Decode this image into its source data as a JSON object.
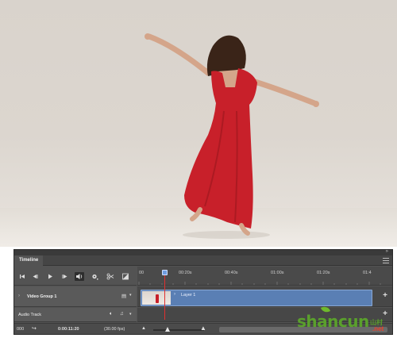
{
  "panel": {
    "title": "Timeline"
  },
  "controls": {
    "go_first": "⏮",
    "prev_frame": "◀",
    "play": "▶",
    "next_frame": "▶",
    "audio": "🔊",
    "settings": "✱",
    "split": "✂",
    "transition": "◪"
  },
  "ruler": {
    "ticks": [
      "00",
      "00:20s",
      "00:40s",
      "01:00s",
      "01:20s",
      "01:4"
    ]
  },
  "tracks": {
    "video_group": {
      "name": "Video Group 1",
      "clip_label": "Layer 1"
    },
    "audio": {
      "name": "Audio Track"
    }
  },
  "bottom": {
    "frame": "000",
    "timecode": "0:00:11:20",
    "fps": "(30.00 fps)"
  },
  "watermark": {
    "main": "shancun",
    "small": "山村",
    "net": ".net"
  },
  "colors": {
    "panel_bg": "#535353",
    "clip_blue": "#5a7fb4",
    "playhead_red": "#e03030",
    "dress_red": "#c8202a"
  }
}
